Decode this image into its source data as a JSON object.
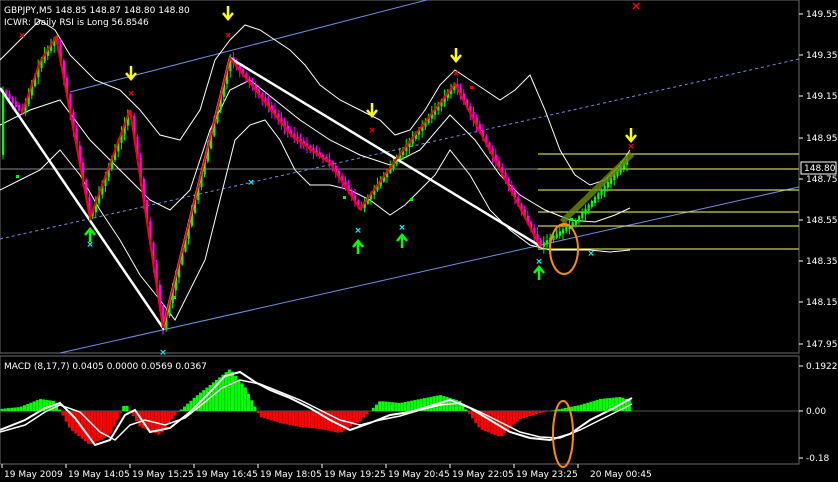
{
  "main_chart": {
    "symbol_line": "GBPJPY,M5  148.85 148.87 148.80 148.80",
    "indicator_line": "ICWR: Daily RSI is Long 56.8546",
    "current_price_label": "148.80",
    "price_levels": [
      "149.55",
      "149.35",
      "149.15",
      "148.95",
      "148.75",
      "148.55",
      "148.35",
      "148.15",
      "147.95"
    ]
  },
  "macd_panel": {
    "header": "MACD  (8,17,7) 0.0405 0.0000 0.0569 0.0367",
    "levels": [
      "0.1922",
      "0.00",
      "-0.18"
    ]
  },
  "time_axis": {
    "labels": [
      "19 May 2009",
      "19 May 14:05",
      "19 May 15:25",
      "19 May 16:45",
      "19 May 18:05",
      "19 May 19:25",
      "19 May 20:45",
      "19 May 22:05",
      "19 May 23:25",
      "20 May 00:45"
    ]
  },
  "colors": {
    "background": "#000000",
    "bull_candle": "#00ff00",
    "bear_candle": "#ff00ff",
    "zigzag_red": "#ff0000",
    "zigzag_white": "#ffffff",
    "channel_blue": "#6f8fe0",
    "arrow_yellow": "#ffff00",
    "arrow_green": "#00ff00",
    "marker_red": "#ff0000",
    "marker_cyan": "#00ffff",
    "highlight_orange": "#ff8c00",
    "fib_yellow": "#ffff66",
    "macd_up": "#00ff00",
    "macd_down": "#ff0000"
  },
  "icons": {
    "down_arrow": "arrow-down-icon",
    "up_arrow": "arrow-up-icon",
    "signal_marker": "x-marker-icon",
    "window_close": "close-icon"
  }
}
